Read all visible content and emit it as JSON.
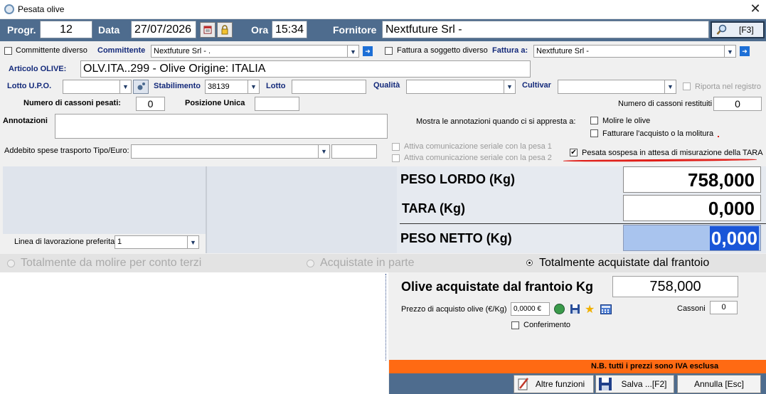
{
  "window": {
    "title": "Pesata olive",
    "close_symbol": "✕"
  },
  "header": {
    "progr_label": "Progr.",
    "progr_value": "12",
    "data_label": "Data",
    "data_value": "27/07/2026",
    "ora_label": "Ora",
    "ora_value": "15:34",
    "fornitore_label": "Fornitore",
    "fornitore_value": "Nextfuture Srl -",
    "search_button": "[F3]"
  },
  "row1": {
    "committente_diverso": "Committente diverso",
    "committente_label": "Committente",
    "committente_value": "Nextfuture Srl - .",
    "fattura_diverso": "Fattura a soggetto diverso",
    "fattura_label": "Fattura a:",
    "fattura_value": "Nextfuture Srl -"
  },
  "articolo": {
    "label": "Articolo OLIVE:",
    "value": "OLV.ITA..299 - Olive Origine: ITALIA"
  },
  "row3": {
    "lotto_upo": "Lotto U.P.O.",
    "stabilimento": "Stabilimento",
    "stabilimento_value": "38139",
    "lotto": "Lotto",
    "qualita": "Qualità",
    "cultivar": "Cultivar",
    "riporta": "Riporta nel registro"
  },
  "row4": {
    "cassoni_pesati": "Numero di cassoni pesati:",
    "cassoni_pesati_value": "0",
    "posizione_unica": "Posizione Unica",
    "cassoni_restituiti": "Numero di cassoni restituiti",
    "cassoni_restituiti_value": "0"
  },
  "annotazioni": {
    "label": "Annotazioni",
    "mostra": "Mostra le annotazioni quando ci si appresta a:",
    "molire": "Molire le olive",
    "fatturare": "Fatturare l'acquisto o la molitura"
  },
  "addebito": {
    "label": "Addebito spese trasporto Tipo/Euro:",
    "seriale1": "Attiva comunicazione seriale con la pesa 1",
    "seriale2": "Attiva comunicazione seriale con la pesa 2",
    "pesata_sospesa": "Pesata sospesa in attesa di misurazione della TARA"
  },
  "weights": {
    "lordo_label": "PESO LORDO (Kg)",
    "lordo_value": "758,000",
    "tara_label": "TARA (Kg)",
    "tara_value": "0,000",
    "netto_label": "PESO NETTO (Kg)",
    "netto_value": "0,000"
  },
  "linea": {
    "label": "Linea di lavorazione preferita",
    "value": "1"
  },
  "radio": {
    "opt1": "Totalmente da molire per conto terzi",
    "opt2": "Acquistate in parte",
    "opt3": "Totalmente acquistate dal frantoio"
  },
  "acquisto": {
    "olive_label": "Olive acquistate dal frantoio Kg",
    "olive_value": "758,000",
    "prezzo_label": "Prezzo di acquisto olive (€/Kg)",
    "prezzo_value": "0,0000 €",
    "cassoni_label": "Cassoni",
    "cassoni_value": "0",
    "conferimento": "Conferimento"
  },
  "footer": {
    "nota": "N.B. tutti i prezzi sono IVA esclusa",
    "altre": "Altre funzioni",
    "salva": "Salva ...[F2]",
    "annulla": "Annulla [Esc]"
  },
  "colors": {
    "header": "#4e6c8e",
    "orange": "#ff6a13",
    "netto_bg": "#a9c4ee",
    "red_line": "#e0201a"
  }
}
